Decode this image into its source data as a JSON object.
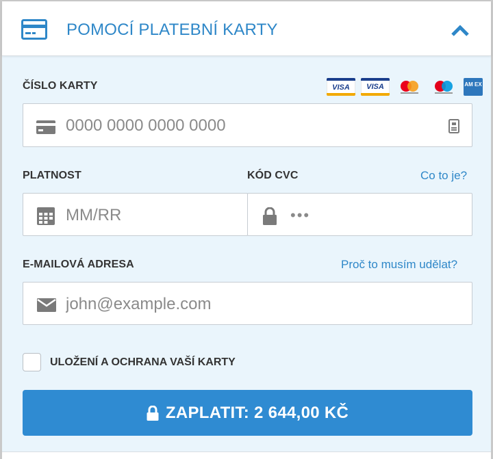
{
  "header": {
    "title": "POMOCÍ PLATEBNÍ KARTY",
    "icon": "credit-card-icon",
    "toggle_icon": "chevron-up-icon"
  },
  "card_number": {
    "label": "ČÍSLO KARTY",
    "placeholder": "0000 0000 0000 0000",
    "value": "",
    "icon": "credit-card-icon",
    "trailing_icon": "card-scan-icon"
  },
  "brands": [
    "Visa",
    "Visa Electron",
    "Mastercard",
    "Maestro",
    "American Express"
  ],
  "brand_texts": {
    "visa": "VISA",
    "visa_electron": "VISA",
    "amex": "AM EX"
  },
  "expiry": {
    "label": "PLATNOST",
    "placeholder": "MM/RR",
    "value": "",
    "icon": "calendar-icon"
  },
  "cvc": {
    "label": "KÓD CVC",
    "help_link": "Co to je?",
    "placeholder": "•••",
    "value": "",
    "icon": "lock-icon"
  },
  "email": {
    "label": "E-MAILOVÁ ADRESA",
    "help_link": "Proč to musím udělat?",
    "placeholder": "john@example.com",
    "value": "",
    "icon": "envelope-icon"
  },
  "save_card": {
    "label": "ULOŽENÍ A OCHRANA VAŠÍ KARTY",
    "checked": false
  },
  "pay_button": {
    "label": "ZAPLATIT: 2 644,00 KČ",
    "icon": "lock-icon"
  },
  "colors": {
    "accent": "#2e87c8",
    "button": "#2f8bd2",
    "panel_bg": "#eaf5fc",
    "icon_gray": "#7a7a7a"
  }
}
